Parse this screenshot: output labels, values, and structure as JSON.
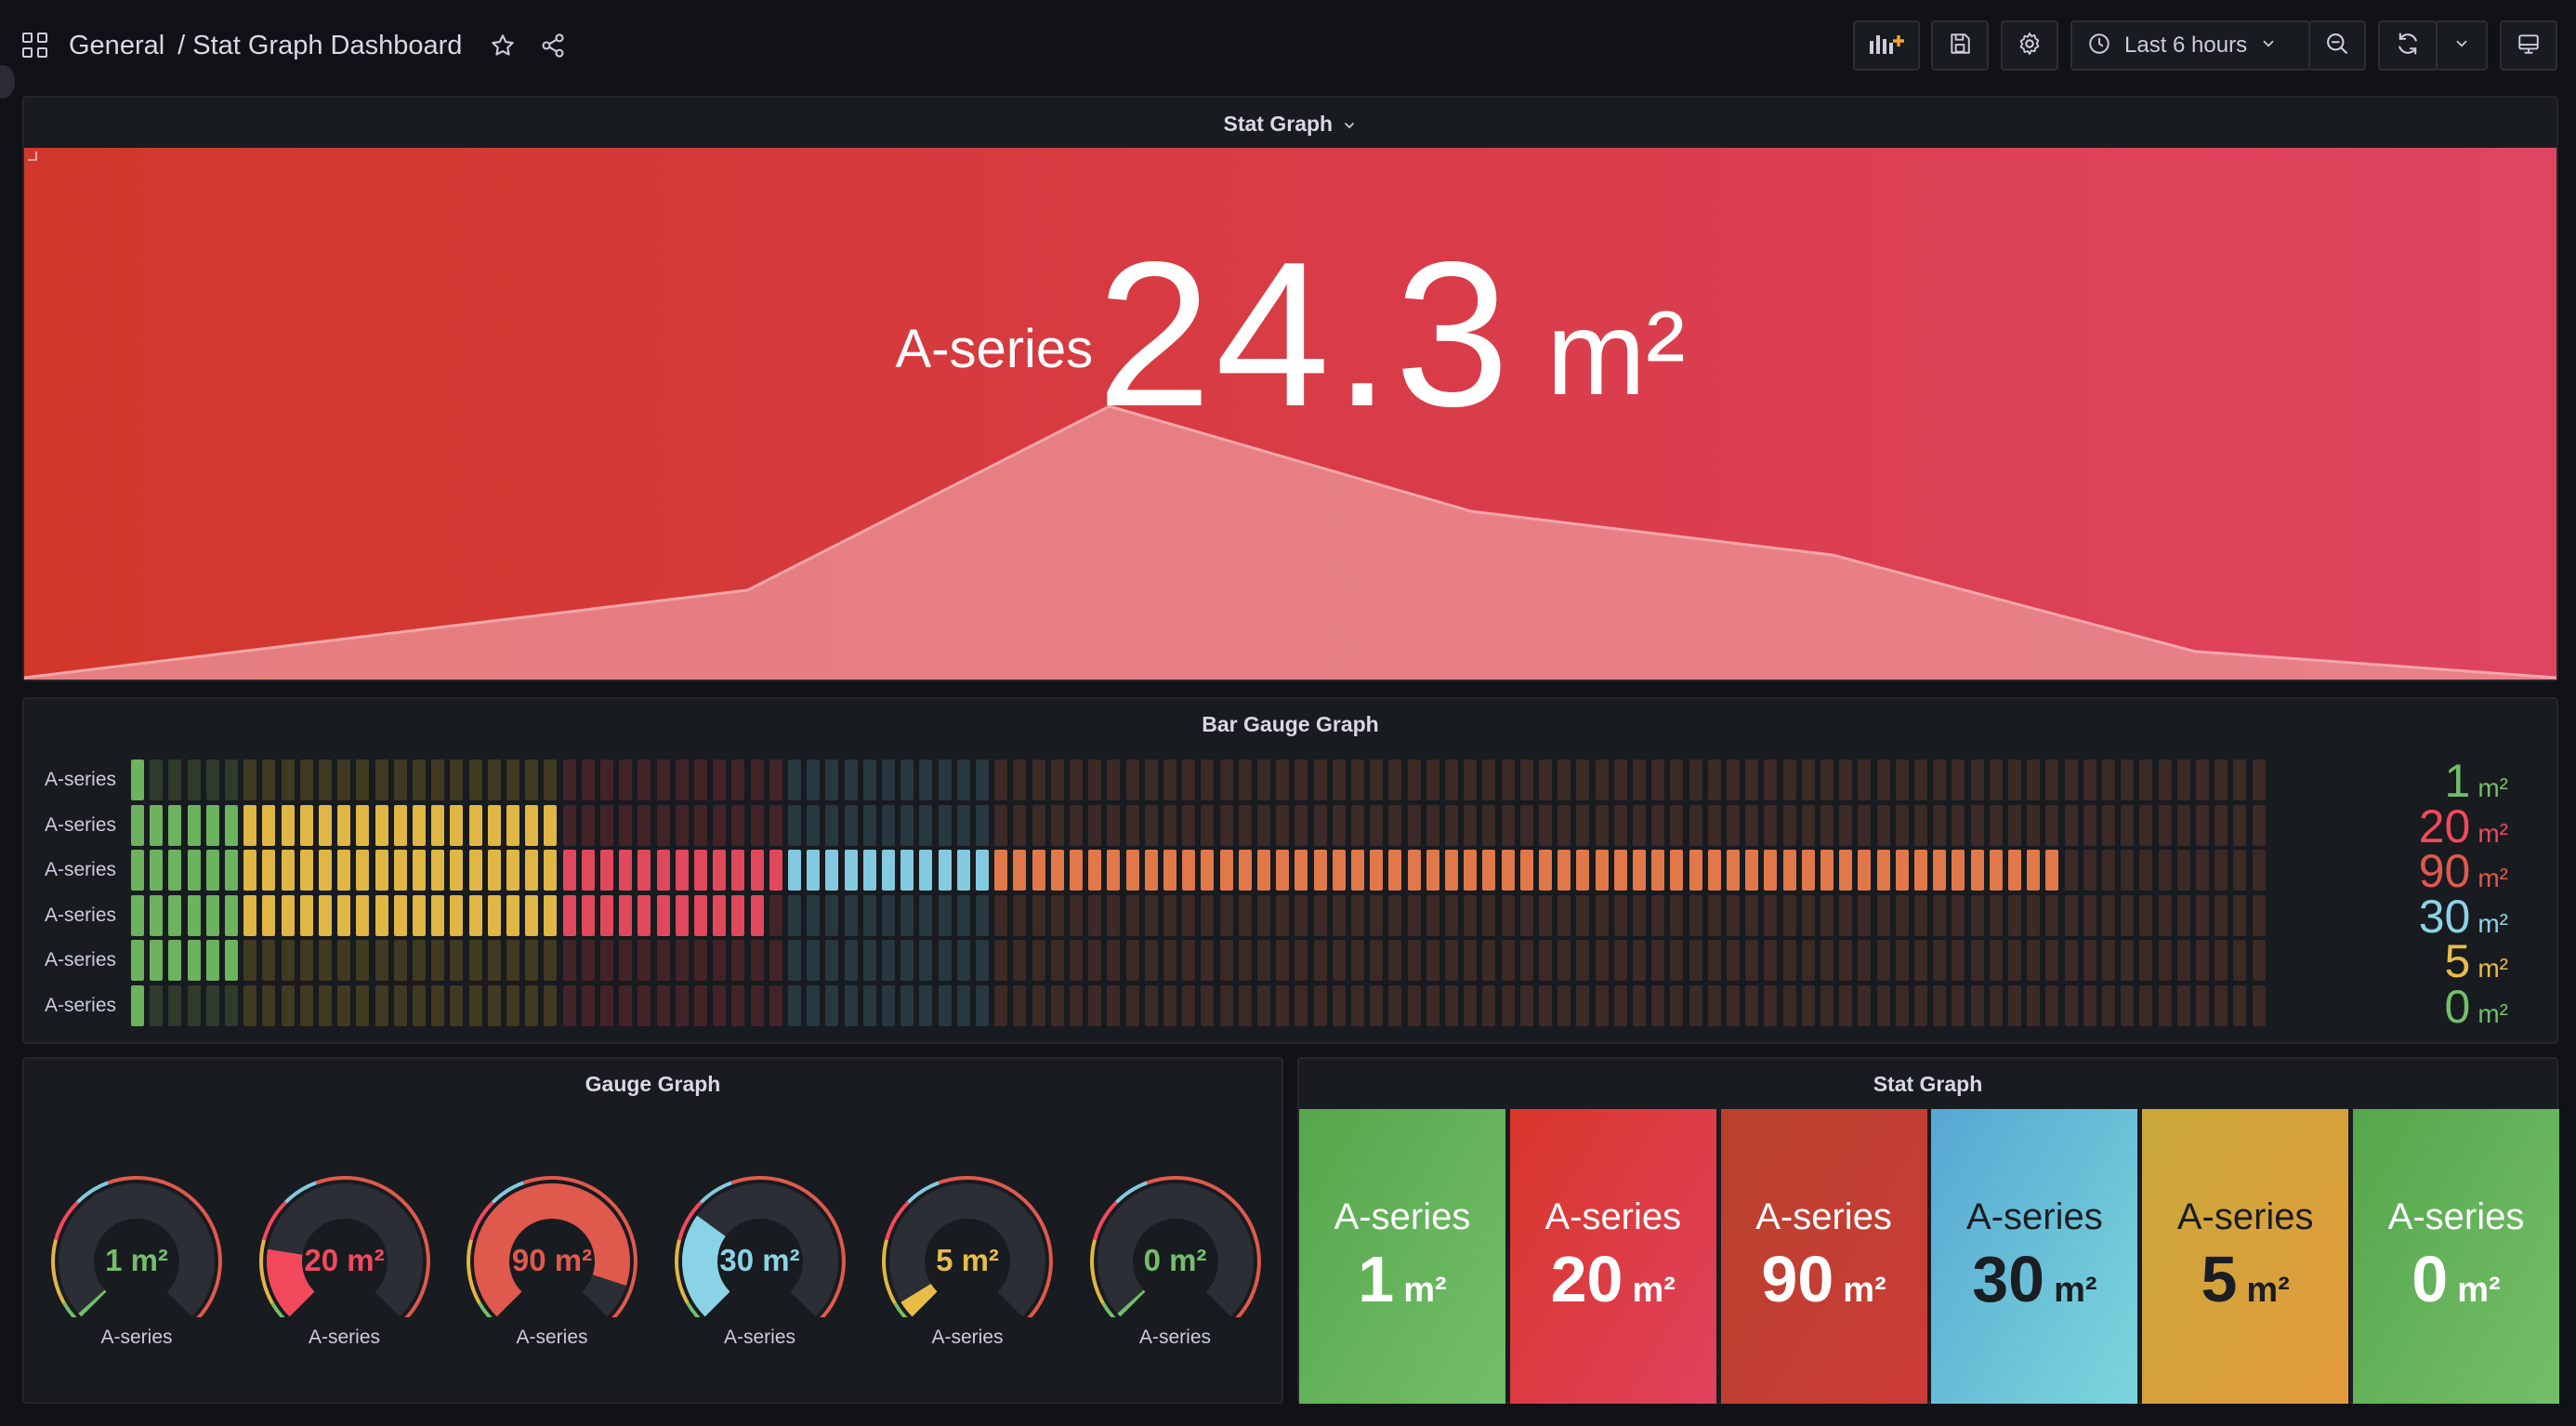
{
  "nav": {
    "breadcrumb_folder": "General",
    "breadcrumb_separator": "/",
    "dashboard_title": "Stat Graph Dashboard",
    "time_range": "Last 6 hours",
    "icons": [
      "apps-icon",
      "star-icon",
      "share-icon",
      "add-panel-icon",
      "save-icon",
      "settings-icon",
      "clock-icon",
      "chevron-down-icon",
      "zoom-out-icon",
      "refresh-icon",
      "chevron-down-icon",
      "tv-mode-icon"
    ]
  },
  "stat_top": {
    "title": "Stat Graph",
    "series": "A-series",
    "value": "24.3",
    "unit": "m²",
    "sparkline": [
      0,
      5,
      10,
      31,
      19,
      14,
      3,
      0
    ],
    "colors": {
      "gradient_start": "#d1372a",
      "gradient_end": "#df4561",
      "fill": "#e98b8e"
    }
  },
  "bar_gauge": {
    "title": "Bar Gauge Graph",
    "rows": [
      {
        "label": "A-series",
        "value": "1",
        "unit": "m²",
        "fraction": 0.01,
        "value_color": "#73bf69"
      },
      {
        "label": "A-series",
        "value": "20",
        "unit": "m²",
        "fraction": 0.2,
        "value_color": "#f2495c"
      },
      {
        "label": "A-series",
        "value": "90",
        "unit": "m²",
        "fraction": 0.9,
        "value_color": "#e0594d"
      },
      {
        "label": "A-series",
        "value": "30",
        "unit": "m²",
        "fraction": 0.3,
        "value_color": "#8ad3e6"
      },
      {
        "label": "A-series",
        "value": "5",
        "unit": "m²",
        "fraction": 0.05,
        "value_color": "#e8bd47"
      },
      {
        "label": "A-series",
        "value": "0",
        "unit": "m²",
        "fraction": 0.0,
        "value_color": "#73bf69"
      }
    ]
  },
  "gauges": {
    "title": "Gauge Graph",
    "items": [
      {
        "value": "1 m²",
        "label": "A-series",
        "fraction": 0.01,
        "color": "#73bf69"
      },
      {
        "value": "20 m²",
        "label": "A-series",
        "fraction": 0.2,
        "color": "#f2495c"
      },
      {
        "value": "90 m²",
        "label": "A-series",
        "fraction": 0.9,
        "color": "#e0594d"
      },
      {
        "value": "30 m²",
        "label": "A-series",
        "fraction": 0.3,
        "color": "#8ad3e6"
      },
      {
        "value": "5 m²",
        "label": "A-series",
        "fraction": 0.05,
        "color": "#e8bd47"
      },
      {
        "value": "0 m²",
        "label": "A-series",
        "fraction": 0.0,
        "color": "#73bf69"
      }
    ]
  },
  "stat_tiles": {
    "title": "Stat Graph",
    "tiles": [
      {
        "series": "A-series",
        "value": "1",
        "unit": "m²",
        "bg_from": "#56a64b",
        "bg_to": "#73bf69",
        "text": "#ffffff"
      },
      {
        "series": "A-series",
        "value": "20",
        "unit": "m²",
        "bg_from": "#d9362a",
        "bg_to": "#e0425d",
        "text": "#ffffff"
      },
      {
        "series": "A-series",
        "value": "90",
        "unit": "m²",
        "bg_from": "#b8412e",
        "bg_to": "#cc3c36",
        "text": "#ffffff"
      },
      {
        "series": "A-series",
        "value": "30",
        "unit": "m²",
        "bg_from": "#57a7d3",
        "bg_to": "#7bd6db",
        "text": "#1a1d22"
      },
      {
        "series": "A-series",
        "value": "5",
        "unit": "m²",
        "bg_from": "#c9a93a",
        "bg_to": "#e39a3c",
        "text": "#1a1d22"
      },
      {
        "series": "A-series",
        "value": "0",
        "unit": "m²",
        "bg_from": "#56a64b",
        "bg_to": "#73bf69",
        "text": "#ffffff"
      }
    ]
  }
}
